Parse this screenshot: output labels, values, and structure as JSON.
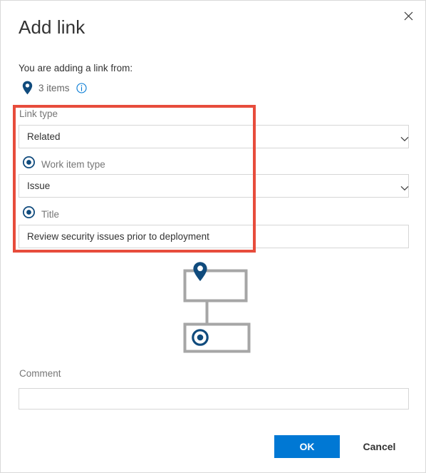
{
  "dialog": {
    "title": "Add link",
    "close_icon": "close-icon",
    "intro": "You are adding a link from:",
    "source": {
      "pin_icon": "map-pin-icon",
      "count_label": "3 items",
      "info_icon": "info-circle-icon"
    }
  },
  "form": {
    "link_type": {
      "label": "Link type",
      "value": "Related",
      "placeholder": "",
      "chevron_icon": "chevron-down-icon"
    },
    "work_item_type": {
      "label": "Work item type",
      "bullet_icon": "target-bullseye-icon",
      "value": "Issue",
      "placeholder": "",
      "chevron_icon": "chevron-down-icon"
    },
    "title_field": {
      "label": "Title",
      "bullet_icon": "target-bullseye-icon",
      "value": "Review security issues prior to deployment",
      "placeholder": ""
    },
    "comment": {
      "label": "Comment",
      "value": "",
      "placeholder": ""
    }
  },
  "diagram": {
    "parent_node_icon": "map-pin-icon",
    "child_node_icon": "target-bullseye-icon"
  },
  "footer": {
    "ok_label": "OK",
    "cancel_label": "Cancel"
  },
  "colors": {
    "accent_blue": "#0078d4",
    "icon_navy": "#104b7d",
    "highlight_red": "#e74c3c",
    "label_gray": "#767676",
    "text_dark": "#333333",
    "field_border": "#d6d6d6",
    "diagram_gray": "#a6a6a6"
  }
}
